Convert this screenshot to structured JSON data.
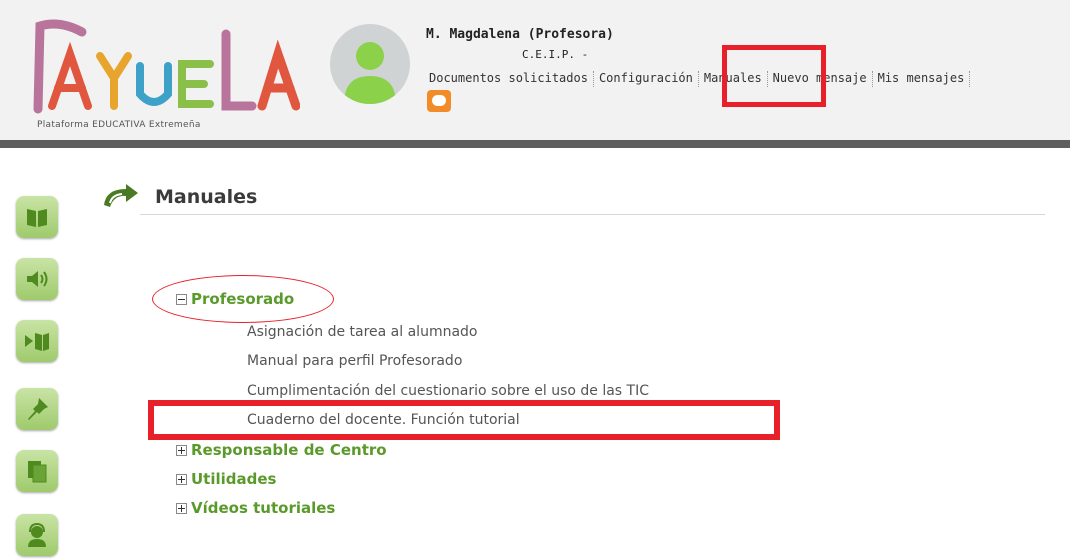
{
  "header": {
    "logo_text": "RAYUELA",
    "logo_subtitle": "Plataforma EDUCATIVA Extremeña",
    "user_name": "M. Magdalena (Profesora)",
    "school": "C.E.I.P. -",
    "nav": [
      {
        "label": "Documentos solicitados"
      },
      {
        "label": "Configuración"
      },
      {
        "label": "Manuales"
      },
      {
        "label": "Nuevo mensaje"
      },
      {
        "label": "Mis mensajes"
      }
    ],
    "chat_icon": "chat-bubble-icon",
    "highlight_color": "#e8202a"
  },
  "sidebar": {
    "items": [
      {
        "icon": "book-icon"
      },
      {
        "icon": "speaker-icon"
      },
      {
        "icon": "book-play-icon"
      },
      {
        "icon": "pushpin-icon"
      },
      {
        "icon": "documents-icon"
      },
      {
        "icon": "support-person-icon"
      }
    ]
  },
  "main": {
    "title": "Manuales",
    "tree": [
      {
        "label": "Profesorado",
        "expanded": true,
        "children": [
          {
            "label": "Asignación de tarea al alumnado"
          },
          {
            "label": "Manual para perfil Profesorado"
          },
          {
            "label": "Cumplimentación del cuestionario sobre el uso de las TIC"
          },
          {
            "label": "Cuaderno del docente. Función tutorial"
          }
        ]
      },
      {
        "label": "Responsable de Centro",
        "expanded": false
      },
      {
        "label": "Utilidades",
        "expanded": false
      },
      {
        "label": "Vídeos tutoriales",
        "expanded": false
      }
    ]
  },
  "colors": {
    "accent_green": "#5a9a2a",
    "header_bar": "#5e5e5e",
    "annotation_red": "#e8202a"
  }
}
